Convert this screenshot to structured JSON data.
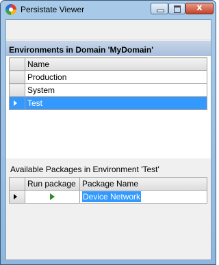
{
  "window": {
    "title": "Persistate Viewer"
  },
  "controls": {
    "close_glyph": "x"
  },
  "environments": {
    "header": "Environments in Domain 'MyDomain'",
    "column": "Name",
    "rows": [
      {
        "name": "Production"
      },
      {
        "name": "System"
      },
      {
        "name": "Test"
      }
    ]
  },
  "packages": {
    "label": "Available Packages in Environment 'Test'",
    "columns": [
      "Run package",
      "Package Name"
    ],
    "rows": [
      {
        "name": "Device Network"
      }
    ]
  },
  "colors": {
    "selection": "#3399ff",
    "play": "#2e8b2e"
  }
}
